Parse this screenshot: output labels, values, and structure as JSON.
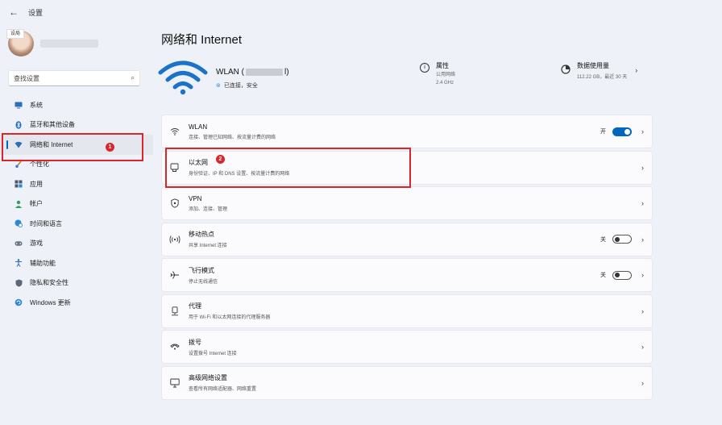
{
  "window": {
    "title": "设置",
    "back": "←"
  },
  "sidebar": {
    "avatar_label": "设局",
    "search_placeholder": "查找设置",
    "items": [
      {
        "label": "系统",
        "icon": "monitor-icon"
      },
      {
        "label": "蓝牙和其他设备",
        "icon": "bluetooth-icon"
      },
      {
        "label": "网络和 Internet",
        "icon": "network-icon",
        "active": true
      },
      {
        "label": "个性化",
        "icon": "brush-icon"
      },
      {
        "label": "应用",
        "icon": "apps-icon"
      },
      {
        "label": "帐户",
        "icon": "account-icon"
      },
      {
        "label": "时间和语言",
        "icon": "globe-clock-icon"
      },
      {
        "label": "游戏",
        "icon": "game-icon"
      },
      {
        "label": "辅助功能",
        "icon": "accessibility-icon"
      },
      {
        "label": "隐私和安全性",
        "icon": "shield-icon"
      },
      {
        "label": "Windows 更新",
        "icon": "update-icon"
      }
    ]
  },
  "annotations": {
    "badge1": "1",
    "badge2": "2"
  },
  "main": {
    "title": "网络和 Internet",
    "connection": {
      "name_prefix": "WLAN (",
      "name_suffix": "l)",
      "status": "已连接，安全"
    },
    "properties": {
      "title": "属性",
      "line1": "公用网络",
      "line2": "2.4 GHz"
    },
    "usage": {
      "title": "数据使用量",
      "detail": "112.22 GB，最近 30 天"
    },
    "cards": [
      {
        "icon": "wifi-icon",
        "title": "WLAN",
        "subtitle": "连接、管理已知网络、按流量计费的网络",
        "toggle": "on",
        "toggle_label": "开"
      },
      {
        "icon": "ethernet-icon",
        "title": "以太网",
        "subtitle": "身份验证、IP 和 DNS 设置、按流量计费的网络"
      },
      {
        "icon": "vpn-shield-icon",
        "title": "VPN",
        "subtitle": "添加、连接、管理"
      },
      {
        "icon": "hotspot-icon",
        "title": "移动热点",
        "subtitle": "共享 Internet 连接",
        "toggle": "off",
        "toggle_label": "关"
      },
      {
        "icon": "airplane-icon",
        "title": "飞行模式",
        "subtitle": "停止无线通信",
        "toggle": "off",
        "toggle_label": "关"
      },
      {
        "icon": "proxy-icon",
        "title": "代理",
        "subtitle": "用于 Wi-Fi 和以太网连接的代理服务器"
      },
      {
        "icon": "dialup-icon",
        "title": "拨号",
        "subtitle": "设置拨号 Internet 连接"
      },
      {
        "icon": "advanced-network-icon",
        "title": "高级网络设置",
        "subtitle": "查看所有网络适配器、网络重置"
      }
    ]
  },
  "colors": {
    "accent": "#0067c0",
    "annotation": "#d8262a",
    "wifi_blue": "#1a73c8"
  }
}
